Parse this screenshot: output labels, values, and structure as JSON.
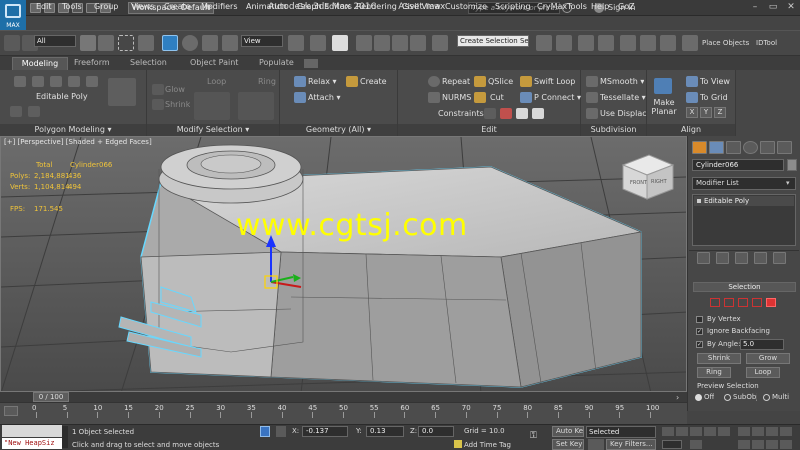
{
  "window": {
    "title": "Autodesk 3ds Max 2016",
    "file": "Asset.max",
    "logo_text": "MAX",
    "workspace": "Workspace: Default",
    "search_placeholder": "Type a keyword or phrase",
    "sign_in": "Sign In"
  },
  "menu": [
    "Edit",
    "Tools",
    "Group",
    "Views",
    "Create",
    "Modifiers",
    "Animation",
    "Graph Editors",
    "Rendering",
    "Civil View",
    "Customize",
    "Scripting",
    "CryMaxTools",
    "Help",
    "GoZ"
  ],
  "toolbar": {
    "filter": "All",
    "coord_system": "View",
    "selection_set": "Create Selection Se",
    "place_objects": "Place Objects",
    "idtool": "IDTool"
  },
  "ribbon_tabs": [
    "Modeling",
    "Freeform",
    "Selection",
    "Object Paint",
    "Populate"
  ],
  "ribbon": {
    "polygon_modeling": {
      "label": "Editable Poly",
      "footer": "Polygon Modeling ▾"
    },
    "modify_selection": {
      "glow": "Glow",
      "shrink": "Shrink",
      "loop": "Loop",
      "ring": "Ring",
      "footer": "Modify Selection ▾"
    },
    "geometry": {
      "relax": "Relax ▾",
      "create": "Create",
      "attach": "Attach ▾",
      "footer": "Geometry (All) ▾"
    },
    "edit": {
      "repeat": "Repeat",
      "qslice": "QSlice",
      "swift_loop": "Swift Loop",
      "nurms": "NURMS",
      "cut": "Cut",
      "p_connect": "P Connect ▾",
      "constraints": "Constraints:",
      "footer": "Edit"
    },
    "subdivision": {
      "msmooth": "MSmooth ▾",
      "tessellate": "Tessellate ▾",
      "use_displace": "Use Displac...",
      "footer": "Subdivision"
    },
    "align": {
      "make_planar": "Make Planar",
      "to_view": "To View",
      "to_grid": "To Grid",
      "x": "X",
      "y": "Y",
      "z": "Z",
      "footer": "Align"
    }
  },
  "viewport": {
    "label": "[+] [Perspective] [Shaded + Edged Faces]",
    "stats": {
      "total": "Total",
      "object": "Cylinder066",
      "polys_label": "Polys:",
      "polys_total": "2,184,881",
      "polys_obj": "436",
      "verts_label": "Verts:",
      "verts_total": "1,104,814",
      "verts_obj": "494",
      "fps_label": "FPS:",
      "fps": "171.545"
    },
    "viewcube": {
      "front": "FRONT",
      "right": "RIGHT"
    },
    "watermark": "www.cgtsj.com"
  },
  "command_panel": {
    "object_name": "Cylinder066",
    "object_color": "#8c8c8c",
    "modifier_list": "Modifier List",
    "stack_item": "Editable Poly",
    "selection": {
      "title": "Selection",
      "by_vertex": "By Vertex",
      "ignore_backfacing": "Ignore Backfacing",
      "by_angle": "By Angle:",
      "angle_value": "5.0",
      "shrink": "Shrink",
      "grow": "Grow",
      "ring": "Ring",
      "loop": "Loop",
      "preview_selection": "Preview Selection",
      "off": "Off",
      "subobj": "SubObj",
      "multi": "Multi"
    }
  },
  "timeline": {
    "slider": "0 / 100",
    "ticks": [
      "0",
      "5",
      "10",
      "15",
      "20",
      "25",
      "30",
      "35",
      "40",
      "45",
      "50",
      "55",
      "60",
      "65",
      "70",
      "75",
      "80",
      "85",
      "90",
      "95",
      "100"
    ]
  },
  "status": {
    "script": "\"New HeapSiz",
    "objects_selected": "1 Object Selected",
    "hint": "Click and drag to select and move objects",
    "x_label": "X:",
    "x": "-0.137",
    "y_label": "Y:",
    "y": "0.13",
    "z_label": "Z:",
    "z": "0.0",
    "grid": "Grid = 10.0",
    "add_time_tag": "Add Time Tag",
    "auto_key": "Auto Key",
    "key_mode": "Selected",
    "set_key": "Set Key",
    "key_filters": "Key Filters..."
  }
}
